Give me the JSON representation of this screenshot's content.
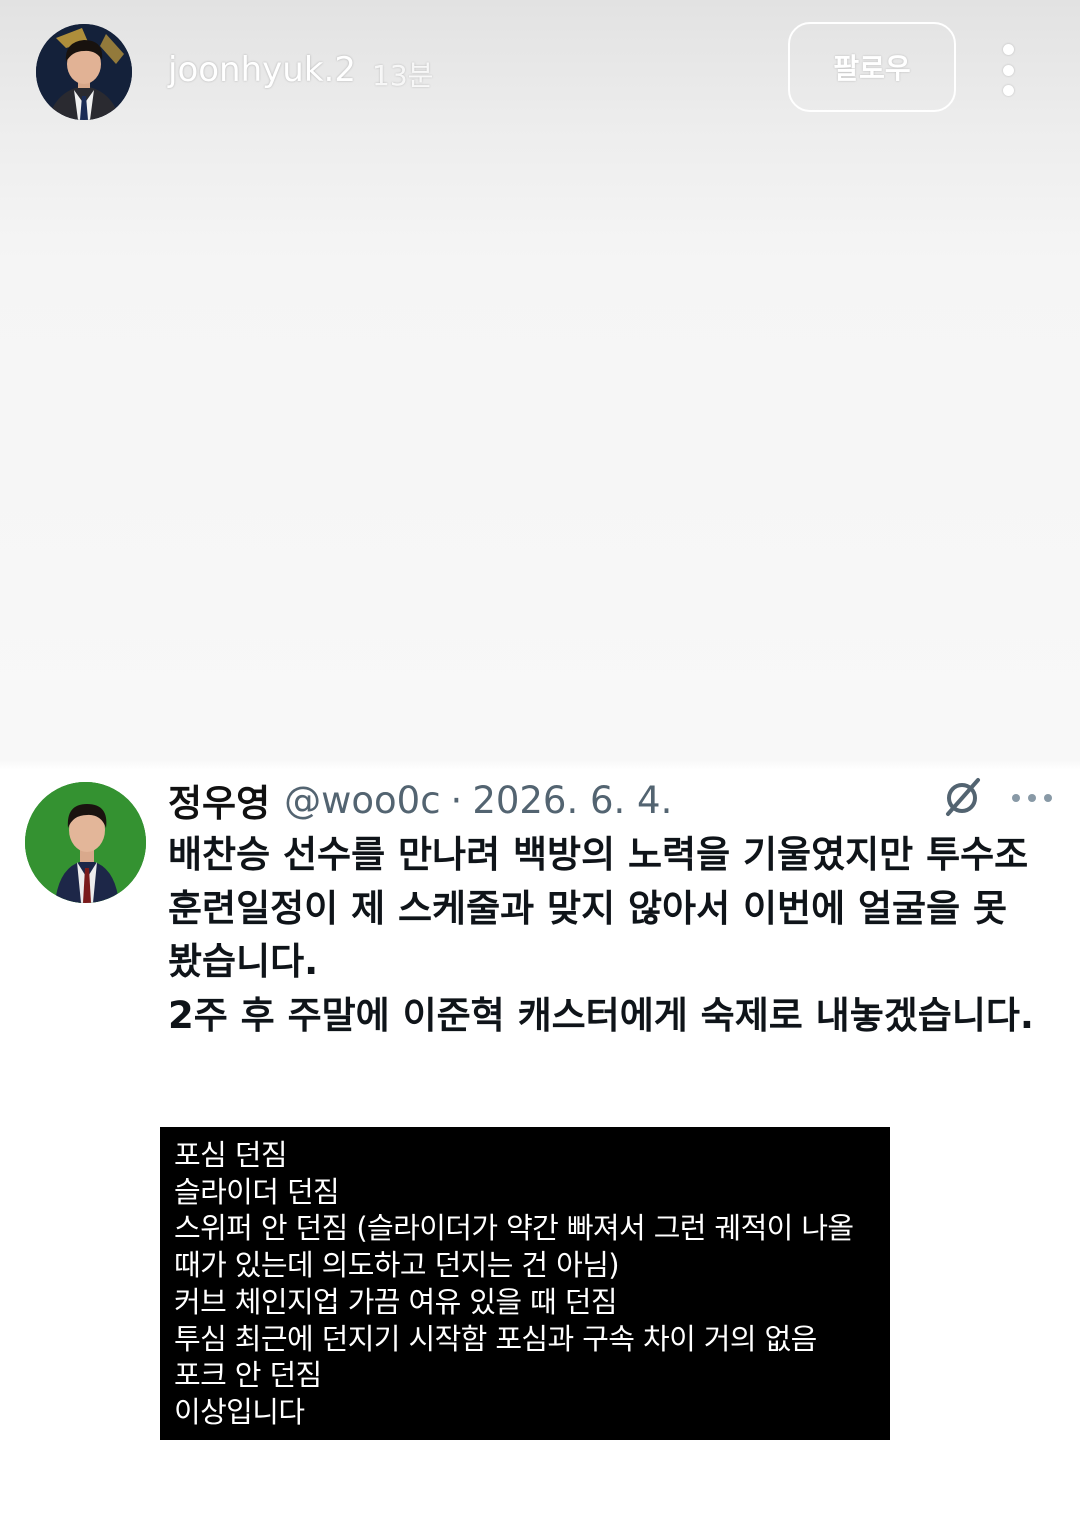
{
  "story": {
    "username": "joonhyuk.2",
    "time_ago": "13분",
    "follow_label": "팔로우",
    "more_icon": "vertical-ellipsis-icon"
  },
  "tweet": {
    "author_name": "정우영",
    "handle": "@woo0c",
    "separator": "·",
    "date": "2026. 6. 4.",
    "grok_icon": "grok-icon",
    "more_icon": "horizontal-ellipsis-icon",
    "paragraphs": [
      "배찬승 선수를 만나려 백방의 노력을 기울였지만 투수조 훈련일정이 제 스케줄과 맞지 않아서 이번에 얼굴을 못봤습니다.",
      "2주 후 주말에 이준혁 캐스터에게 숙제로 내놓겠습니다."
    ],
    "attachment_lines": [
      "포심 던짐",
      "슬라이더 던짐",
      "스위퍼 안 던짐 (슬라이더가 약간 빠져서 그런 궤적이 나올",
      "때가 있는데 의도하고 던지는 건 아님)",
      "커브 체인지업 가끔 여유 있을 때 던짐",
      "투심 최근에 던지기 시작함 포심과 구속 차이 거의 없음",
      "포크 안 던짐",
      "이상입니다"
    ]
  },
  "colors": {
    "story_text": "#ffffff",
    "tweet_text": "#0f1419",
    "secondary_text": "#536471",
    "attachment_bg": "#000000",
    "tweet_avatar_bg": "#2e8b2c"
  }
}
